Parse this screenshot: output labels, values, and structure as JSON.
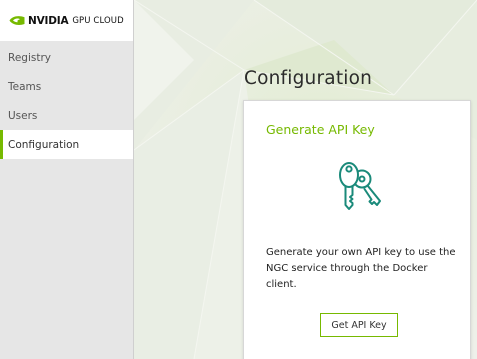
{
  "brand": {
    "name": "NVIDIA",
    "product": "GPU CLOUD",
    "logo_icon": "nvidia-eye-icon"
  },
  "sidebar": {
    "items": [
      {
        "label": "Registry",
        "active": false
      },
      {
        "label": "Teams",
        "active": false
      },
      {
        "label": "Users",
        "active": false
      },
      {
        "label": "Configuration",
        "active": true
      }
    ]
  },
  "main": {
    "title": "Configuration",
    "card": {
      "title": "Generate API Key",
      "icon": "keys-icon",
      "description": "Generate your own API key to use the NGC service through the Docker client.",
      "button_label": "Get API Key"
    }
  },
  "colors": {
    "accent": "#76b900",
    "sidebar_bg": "#e6e6e6",
    "main_bg": "#eef0ea"
  }
}
